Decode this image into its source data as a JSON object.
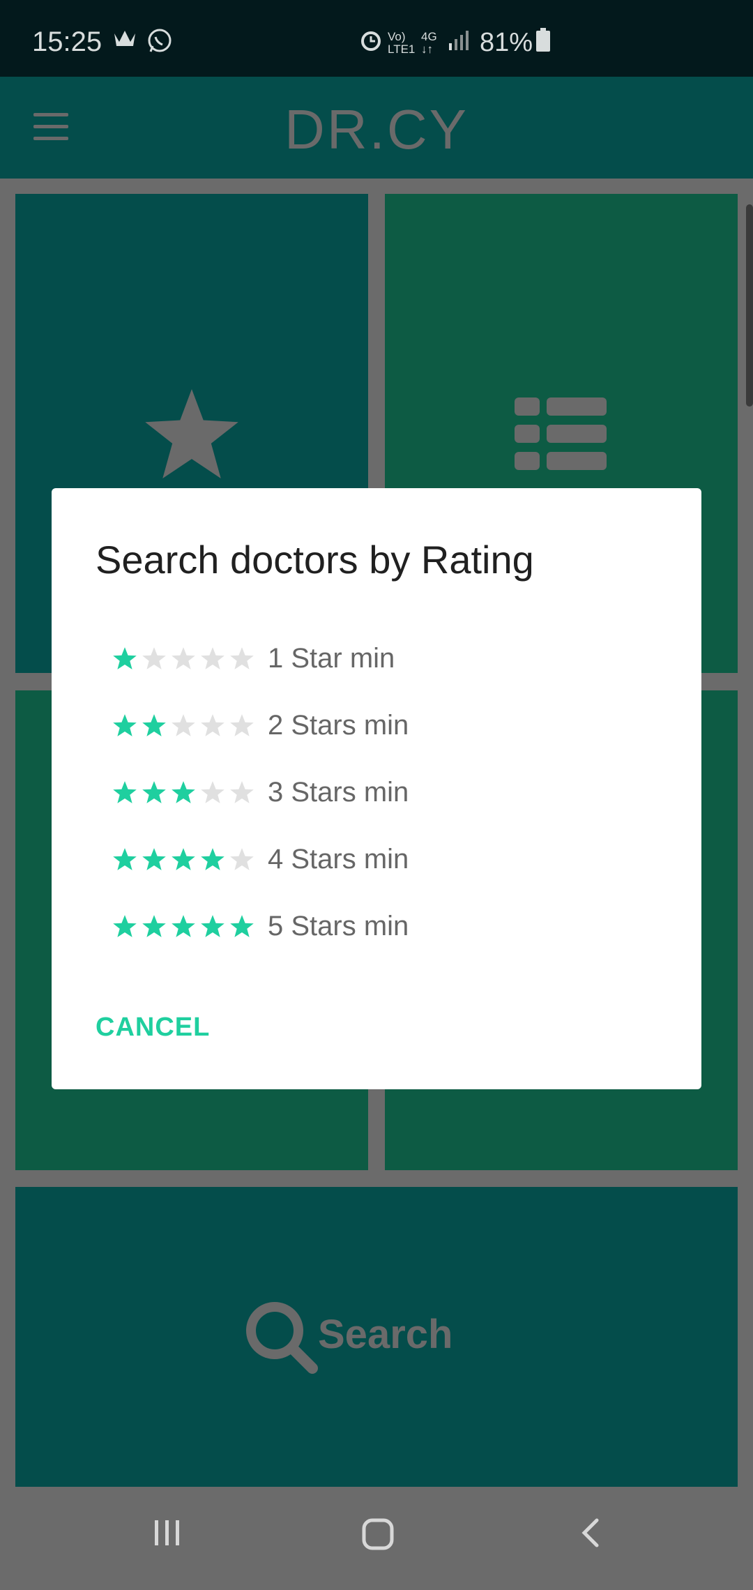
{
  "status_bar": {
    "time": "15:25",
    "battery": "81%",
    "icons": [
      "crown-icon",
      "whatsapp-icon",
      "alarm-icon",
      "volte-icon",
      "4g-icon",
      "signal-icon",
      "battery-icon"
    ]
  },
  "app_bar": {
    "title": "DR.CY"
  },
  "tiles": {
    "search_label": "Search"
  },
  "dialog": {
    "title": "Search doctors by Rating",
    "options": [
      {
        "label": "1 Star min",
        "rating": 1
      },
      {
        "label": "2 Stars min",
        "rating": 2
      },
      {
        "label": "3 Stars min",
        "rating": 3
      },
      {
        "label": "4 Stars min",
        "rating": 4
      },
      {
        "label": "5 Stars min",
        "rating": 5
      }
    ],
    "cancel_label": "CANCEL"
  },
  "colors": {
    "accent": "#1fcf9f",
    "star_off": "#e0e0e0",
    "tile_teal": "#044d4b",
    "tile_green": "#0d5b44"
  }
}
